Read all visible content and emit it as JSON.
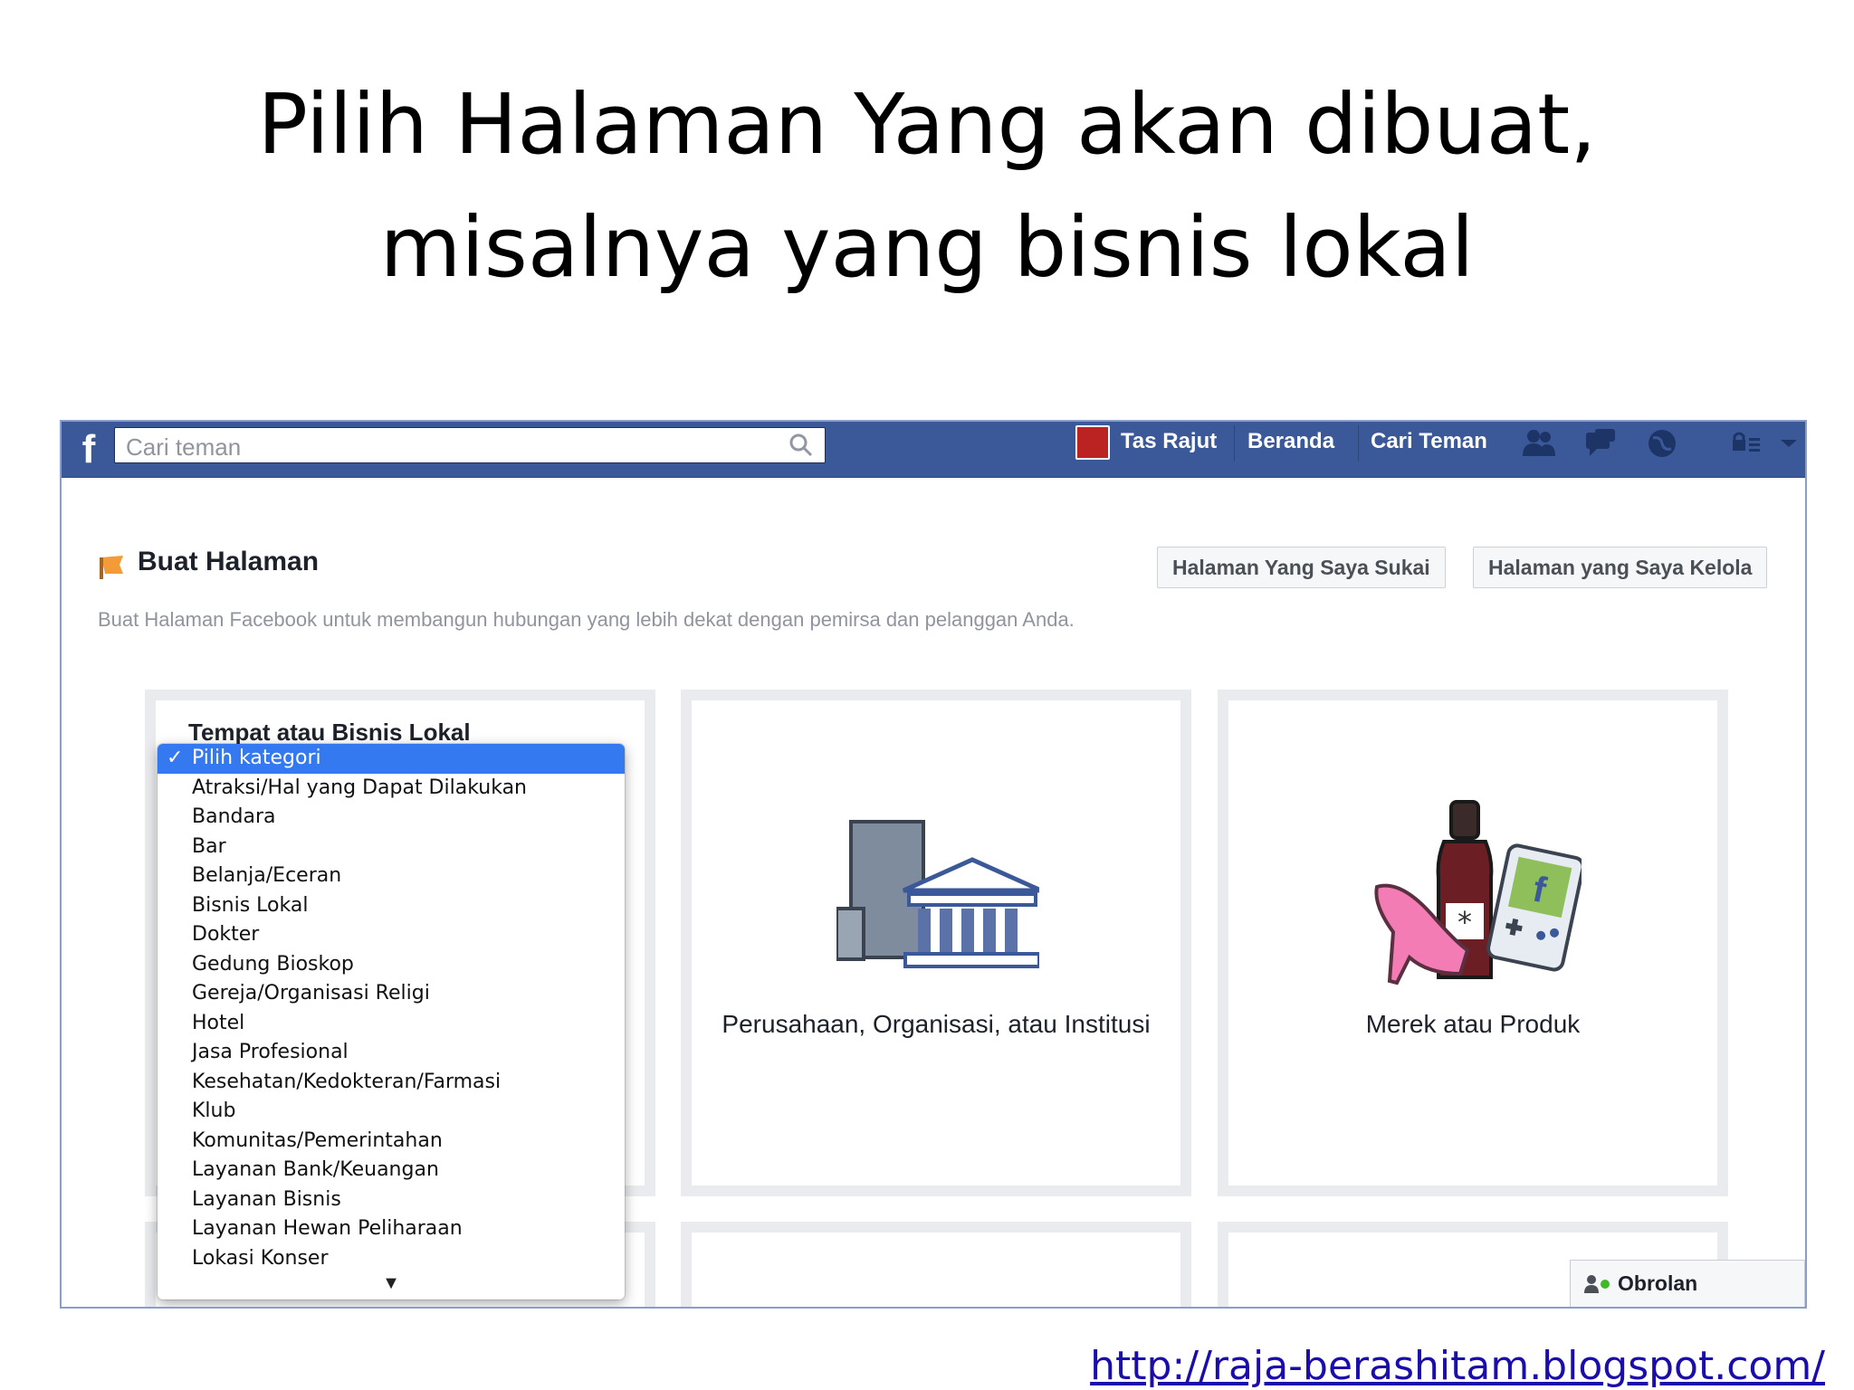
{
  "slide": {
    "title_line1": "Pilih Halaman Yang akan dibuat,",
    "title_line2": "misalnya yang bisnis lokal",
    "footer_url": "http://raja-berashitam.blogspot.com/"
  },
  "topbar": {
    "search_placeholder": "Cari teman",
    "profile_name": "Tas Rajut",
    "home": "Beranda",
    "find_friends": "Cari Teman"
  },
  "page": {
    "title": "Buat Halaman",
    "description": "Buat Halaman Facebook untuk membangun hubungan yang lebih dekat dengan pemirsa dan pelanggan Anda.",
    "btn_liked": "Halaman Yang Saya Sukai",
    "btn_managed": "Halaman yang Saya Kelola"
  },
  "cards": {
    "local": {
      "title": "Tempat atau Bisnis Lokal"
    },
    "company": {
      "label": "Perusahaan, Organisasi, atau Institusi"
    },
    "brand": {
      "label": "Merek atau Produk"
    }
  },
  "dropdown": {
    "selected": "Pilih kategori",
    "options": [
      "Atraksi/Hal yang Dapat Dilakukan",
      "Bandara",
      "Bar",
      "Belanja/Eceran",
      "Bisnis Lokal",
      "Dokter",
      "Gedung Bioskop",
      "Gereja/Organisasi Religi",
      "Hotel",
      "Jasa Profesional",
      "Kesehatan/Kedokteran/Farmasi",
      "Klub",
      "Komunitas/Pemerintahan",
      "Layanan Bank/Keuangan",
      "Layanan Bisnis",
      "Layanan Hewan Peliharaan",
      "Lokasi Konser"
    ]
  },
  "chat": {
    "label": "Obrolan"
  },
  "colors": {
    "fb_blue": "#3b5998",
    "selection_blue": "#3479f0",
    "link_blue": "#1a0dab"
  }
}
